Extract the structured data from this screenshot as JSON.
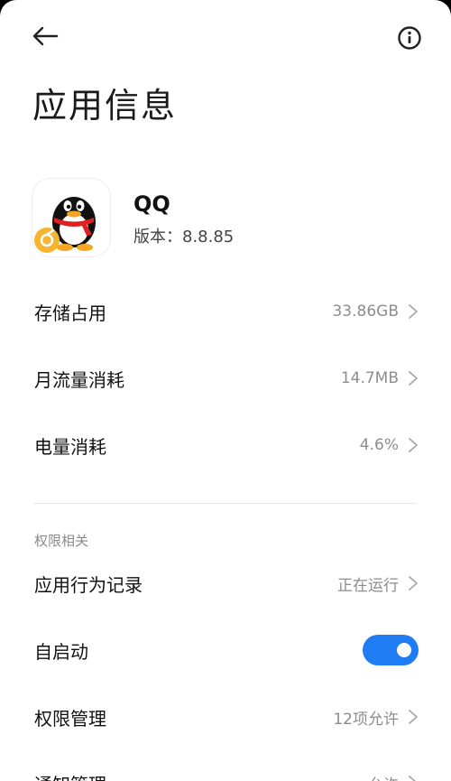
{
  "header": {
    "title": "应用信息",
    "back_icon": "arrow-left-icon",
    "info_icon": "info-circle-icon"
  },
  "app": {
    "name": "QQ",
    "version": "版本：8.8.85",
    "icon": "qq-penguin-icon"
  },
  "usage": [
    {
      "label": "存储占用",
      "value": "33.86GB"
    },
    {
      "label": "月流量消耗",
      "value": "14.7MB"
    },
    {
      "label": "电量消耗",
      "value": "4.6%"
    }
  ],
  "permissions": {
    "section_title": "权限相关",
    "items": [
      {
        "label": "应用行为记录",
        "value": "正在运行"
      },
      {
        "label": "自启动",
        "toggle": true
      },
      {
        "label": "权限管理",
        "value": "12项允许"
      },
      {
        "label": "通知管理",
        "value": "允许"
      }
    ]
  },
  "colors": {
    "accent": "#1f7cf3",
    "secondary_text": "#8d8d8d"
  }
}
